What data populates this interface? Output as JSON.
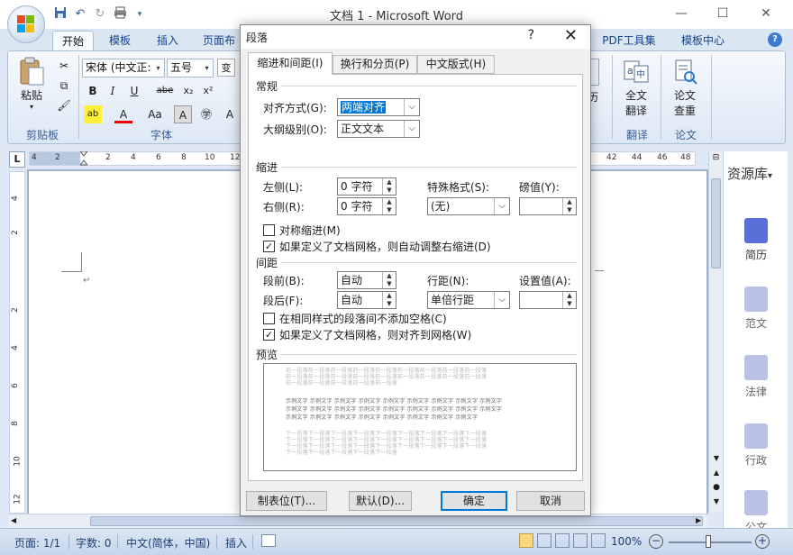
{
  "window": {
    "title": "文档 1 - Microsoft Word",
    "minimize": "—",
    "maximize": "☐",
    "close": "✕"
  },
  "qat": [
    "save-icon",
    "undo-icon",
    "redo-icon",
    "print-icon",
    "dropdown-icon"
  ],
  "ribbon_tabs": [
    {
      "label": "开始",
      "active": true
    },
    {
      "label": "模板"
    },
    {
      "label": "插入"
    },
    {
      "label": "页面布"
    },
    {
      "label": "PDF工具集"
    },
    {
      "label": "模板中心"
    }
  ],
  "ribbon": {
    "clipboard": {
      "paste": "粘贴",
      "label": "剪贴板"
    },
    "font": {
      "name": "宋体 (中文正:",
      "size": "五号",
      "label": "字体",
      "buttons": [
        "B",
        "I",
        "U",
        "abe",
        "x₂",
        "x²",
        "ab",
        "A",
        "Aa",
        "A",
        "㊫",
        "A"
      ]
    },
    "translate": {
      "full": "全文",
      "full2": "翻译",
      "label": "翻译"
    },
    "paper": {
      "check": "论文",
      "check2": "查重",
      "label": "论文"
    },
    "resume_partial": "历"
  },
  "hruler": [
    "4",
    "2",
    "2",
    "4",
    "6",
    "8",
    "10",
    "12",
    "42",
    "44",
    "46",
    "48"
  ],
  "vruler": [
    "4",
    "2",
    "2",
    "4",
    "6",
    "8",
    "10",
    "12"
  ],
  "sidepanel": {
    "title": "资源库",
    "items": [
      "简历",
      "范文",
      "法律",
      "行政",
      "公文"
    ]
  },
  "statusbar": {
    "page": "页面: 1/1",
    "words": "字数: 0",
    "lang": "中文(简体，中国)",
    "mode": "插入",
    "zoom": "100%"
  },
  "dialog": {
    "title": "段落",
    "help": "?",
    "close": "✕",
    "tabs": [
      {
        "label": "缩进和间距(I)",
        "active": true
      },
      {
        "label": "换行和分页(P)"
      },
      {
        "label": "中文版式(H)"
      }
    ],
    "general": {
      "heading": "常规",
      "align_label": "对齐方式(G):",
      "align_value": "两端对齐",
      "outline_label": "大纲级别(O):",
      "outline_value": "正文文本"
    },
    "indent": {
      "heading": "缩进",
      "left_label": "左侧(L):",
      "left_value": "0 字符",
      "right_label": "右侧(R):",
      "right_value": "0 字符",
      "special_label": "特殊格式(S):",
      "special_value": "(无)",
      "by_label": "磅值(Y):",
      "mirror": "对称缩进(M)",
      "auto_adjust": "如果定义了文档网格，则自动调整右缩进(D)"
    },
    "spacing": {
      "heading": "间距",
      "before_label": "段前(B):",
      "before_value": "自动",
      "after_label": "段后(F):",
      "after_value": "自动",
      "line_label": "行距(N):",
      "line_value": "单倍行距",
      "at_label": "设置值(A):",
      "no_space": "在相同样式的段落间不添加空格(C)",
      "snap_grid": "如果定义了文档网格，则对齐到网格(W)"
    },
    "preview": {
      "heading": "预览",
      "prev_line": "前一段落前一段落前一段落前一段落前一段落前一段落前一段落前一段落前一段落",
      "prev_short": "前一段落前一段落前一段落前一段落前一段落",
      "sample_line": "示例文字 示例文字 示例文字 示例文字 示例文字 示例文字 示例文字 示例文字 示例文字",
      "sample_short": "示例文字 示例文字 示例文字 示例文字 示例文字 示例文字 示例文字 示例文字",
      "next_line": "下一段落下一段落下一段落下一段落下一段落下一段落下一段落下一段落下一段落",
      "next_short": "下一段落下一段落下一段落下一段落下一段落"
    },
    "buttons": {
      "tabs": "制表位(T)...",
      "default": "默认(D)...",
      "ok": "确定",
      "cancel": "取消"
    }
  },
  "colors": {
    "accent": "#0078d7",
    "ribbon_text": "#15428b",
    "selection": "#0078d7"
  }
}
